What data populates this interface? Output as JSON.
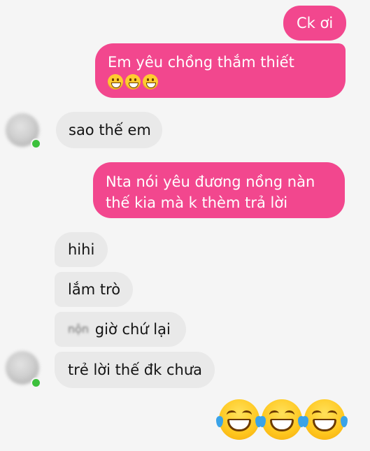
{
  "messages": [
    {
      "sender": "me",
      "lines": [
        "Ck ơi"
      ]
    },
    {
      "sender": "me",
      "lines": [
        "Em yêu chồng thắm thiết"
      ],
      "emoji": [
        "grinning-face",
        "grinning-face",
        "grinning-face"
      ]
    },
    {
      "sender": "partner",
      "lines": [
        "sao thế em"
      ]
    },
    {
      "sender": "me",
      "lines": [
        "Nta nói yêu đương nồng nàn",
        "thế kia mà k thèm trả lời"
      ]
    },
    {
      "sender": "partner",
      "lines": [
        "hihi"
      ]
    },
    {
      "sender": "partner",
      "lines": [
        "lắm trò"
      ]
    },
    {
      "sender": "partner",
      "lines": [
        "giờ chứ lại"
      ],
      "blurred_prefix": "nộn"
    },
    {
      "sender": "partner",
      "lines": [
        "trẻ lời thế đk chưa"
      ]
    },
    {
      "sender": "me",
      "emoji": [
        "tears-of-joy-face",
        "tears-of-joy-face",
        "tears-of-joy-face"
      ]
    }
  ],
  "colors": {
    "outgoing_bubble": "#f2478e",
    "incoming_bubble": "#e9e9e9",
    "background": "#f5f5f5",
    "online_dot": "#3cc03c"
  },
  "icons": {
    "avatar": "blurred-avatar",
    "online_status": "green-dot-icon"
  }
}
